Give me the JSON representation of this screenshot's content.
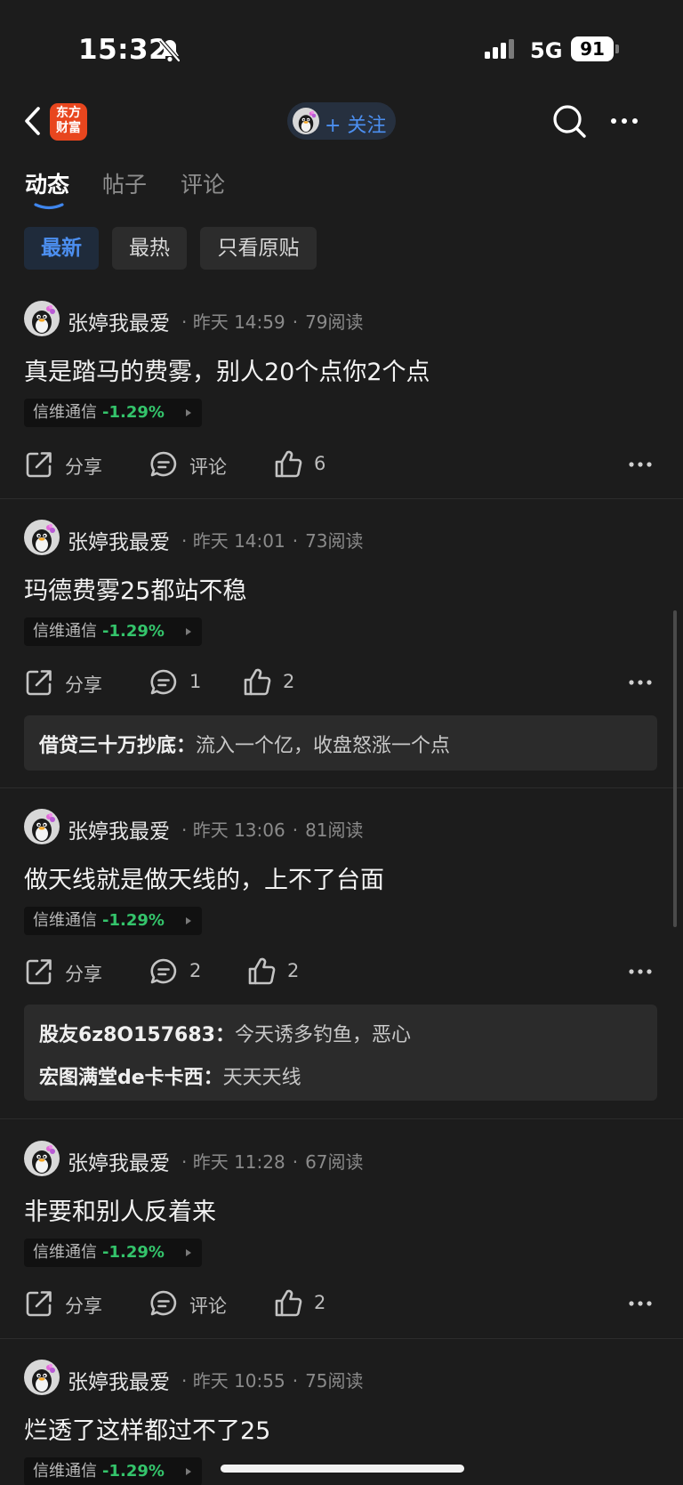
{
  "status": {
    "time": "15:32",
    "network": "5G",
    "battery": "91"
  },
  "nav": {
    "app_logo_text": "东方财富",
    "follow_label": "+ 关注"
  },
  "tabs": [
    {
      "label": "动态",
      "active": true
    },
    {
      "label": "帖子",
      "active": false
    },
    {
      "label": "评论",
      "active": false
    }
  ],
  "filters": [
    {
      "label": "最新",
      "active": true
    },
    {
      "label": "最热",
      "active": false
    },
    {
      "label": "只看原贴",
      "active": false
    }
  ],
  "posts": [
    {
      "author": "张婷我最爱",
      "date": "昨天 14:59",
      "reads": "79阅读",
      "content": "真是踏马的费雾，别人20个点你2个点",
      "stock": {
        "name": "信维通信",
        "change": "-1.29%"
      },
      "share": "分享",
      "comment": "评论",
      "like": "6",
      "replies": []
    },
    {
      "author": "张婷我最爱",
      "date": "昨天 14:01",
      "reads": "73阅读",
      "content": "玛德费雾25都站不稳",
      "stock": {
        "name": "信维通信",
        "change": "-1.29%"
      },
      "share": "分享",
      "comment": "1",
      "like": "2",
      "replies": [
        {
          "user": "借贷三十万抄底：",
          "text": "流入一个亿，收盘怒涨一个点"
        }
      ]
    },
    {
      "author": "张婷我最爱",
      "date": "昨天 13:06",
      "reads": "81阅读",
      "content": "做天线就是做天线的，上不了台面",
      "stock": {
        "name": "信维通信",
        "change": "-1.29%"
      },
      "share": "分享",
      "comment": "2",
      "like": "2",
      "replies": [
        {
          "user": "股友6z8O157683：",
          "text": "今天诱多钓鱼，恶心"
        },
        {
          "user": "宏图满堂de卡卡西：",
          "text": "天天天线"
        }
      ]
    },
    {
      "author": "张婷我最爱",
      "date": "昨天 11:28",
      "reads": "67阅读",
      "content": "非要和别人反着来",
      "stock": {
        "name": "信维通信",
        "change": "-1.29%"
      },
      "share": "分享",
      "comment": "评论",
      "like": "2",
      "replies": []
    },
    {
      "author": "张婷我最爱",
      "date": "昨天 10:55",
      "reads": "75阅读",
      "content": "烂透了这样都过不了25",
      "stock": {
        "name": "信维通信",
        "change": "-1.29%"
      },
      "replies": []
    }
  ],
  "colors": {
    "background": "#1c1c1c",
    "accent_blue": "#4c8ff0",
    "stock_green": "#34c46b",
    "brand_orange": "#e8461e"
  }
}
